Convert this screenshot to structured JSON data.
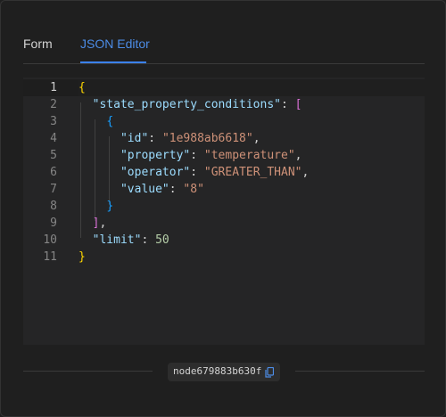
{
  "tabs": [
    {
      "label": "Form",
      "active": false
    },
    {
      "label": "JSON Editor",
      "active": true
    }
  ],
  "editor": {
    "active_line": 1,
    "lines": [
      {
        "n": "1",
        "text": "{"
      },
      {
        "n": "2",
        "text": "  \"state_property_conditions\": ["
      },
      {
        "n": "3",
        "text": "    {"
      },
      {
        "n": "4",
        "text": "      \"id\": \"1e988ab6618\","
      },
      {
        "n": "5",
        "text": "      \"property\": \"temperature\","
      },
      {
        "n": "6",
        "text": "      \"operator\": \"GREATER_THAN\","
      },
      {
        "n": "7",
        "text": "      \"value\": \"8\""
      },
      {
        "n": "8",
        "text": "    }"
      },
      {
        "n": "9",
        "text": "  ],"
      },
      {
        "n": "10",
        "text": "  \"limit\": 50"
      },
      {
        "n": "11",
        "text": "}"
      }
    ]
  },
  "footer": {
    "node_id": "node679883b630f",
    "copy_icon": "copy-icon"
  },
  "colors": {
    "accent": "#3b82f6",
    "key": "#9cdcfe",
    "string": "#ce9178",
    "number": "#b5cea8"
  }
}
